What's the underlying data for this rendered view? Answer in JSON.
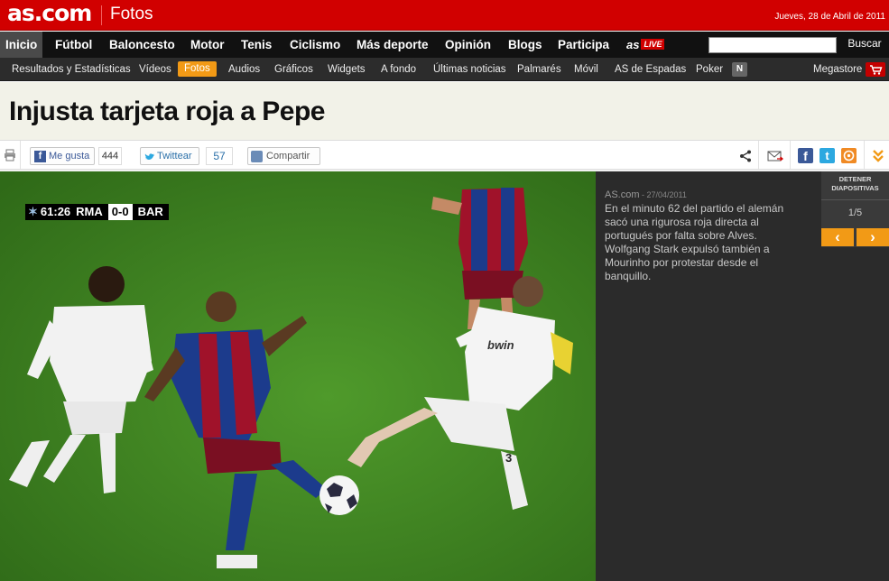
{
  "header": {
    "logo": "as.com",
    "section": "Fotos",
    "date": "Jueves, 28 de Abril de 2011"
  },
  "main_nav": {
    "items": [
      "Inicio",
      "Fútbol",
      "Baloncesto",
      "Motor",
      "Tenis",
      "Ciclismo",
      "Más deporte",
      "Opinión",
      "Blogs",
      "Participa"
    ],
    "active": "Inicio",
    "as_live": "as",
    "as_live_badge": "LIVE",
    "search_button": "Buscar",
    "search_value": ""
  },
  "sub_nav": {
    "items": [
      "Resultados y Estadísticas",
      "Vídeos",
      "Fotos",
      "Audios",
      "Gráficos",
      "Widgets",
      "A fondo",
      "Últimas noticias",
      "Palmarés",
      "Móvil",
      "AS de Espadas",
      "Poker"
    ],
    "active": "Fotos",
    "badge": "N",
    "megastore": "Megastore"
  },
  "article": {
    "headline": "Injusta tarjeta roja a Pepe"
  },
  "toolbar": {
    "like_label": "Me gusta",
    "like_count": "444",
    "tweet_label": "Twittear",
    "tweet_count": "57",
    "share_label": "Compartir"
  },
  "photo": {
    "scoreboard_time": "61:26",
    "home_team": "RMA",
    "score": "0-0",
    "away_team": "BAR",
    "jersey_text": "bwin",
    "jersey_number": "3"
  },
  "caption": {
    "source": "AS.com",
    "date": "27/04/2011",
    "text": "En el minuto 62 del partido el alemán sacó una rigurosa roja directa al portugués por falta sobre Alves. Wolfgang Stark expulsó también a Mourinho por protestar desde el banquillo."
  },
  "slideshow": {
    "stop_label_line1": "DETENER",
    "stop_label_line2": "DIAPOSITIVAS",
    "counter": "1/5",
    "prev": "‹",
    "next": "›"
  },
  "colors": {
    "brand_red": "#d10000",
    "accent_orange": "#f29a16",
    "nav_dark": "#111111"
  }
}
